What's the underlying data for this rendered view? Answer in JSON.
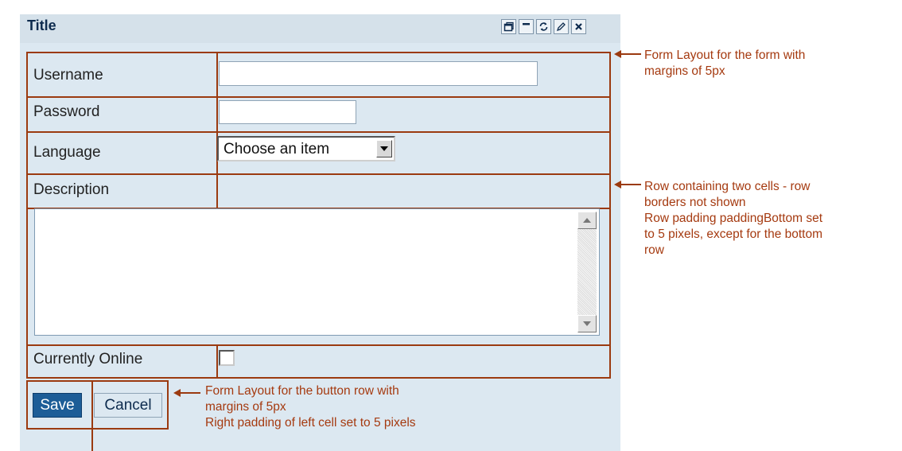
{
  "portlet": {
    "title": "Title",
    "tool_icons": [
      "restore-icon",
      "minimize-icon",
      "refresh-icon",
      "edit-icon",
      "close-icon"
    ]
  },
  "form": {
    "username_label": "Username",
    "username_value": "",
    "password_label": "Password",
    "password_value": "",
    "language_label": "Language",
    "language_selected": "Choose an item",
    "description_label": "Description",
    "description_value": "",
    "online_label": "Currently Online",
    "online_checked": false
  },
  "buttons": {
    "save_label": "Save",
    "cancel_label": "Cancel"
  },
  "annotations": {
    "form_layout": [
      "Form Layout for the form with",
      "margins of 5px"
    ],
    "row": [
      "Row containing two cells - row",
      "borders not shown",
      "Row padding paddingBottom set",
      "to 5 pixels, except for the bottom",
      "row"
    ],
    "button_row": [
      "Form Layout for the button row with",
      "margins of 5px",
      "Right padding of left cell set to 5 pixels"
    ]
  },
  "colors": {
    "annotation": "#a53a10",
    "layout_line": "#9b3a10",
    "panel_background": "#dce8f1",
    "save_button": "#1d5d97"
  }
}
